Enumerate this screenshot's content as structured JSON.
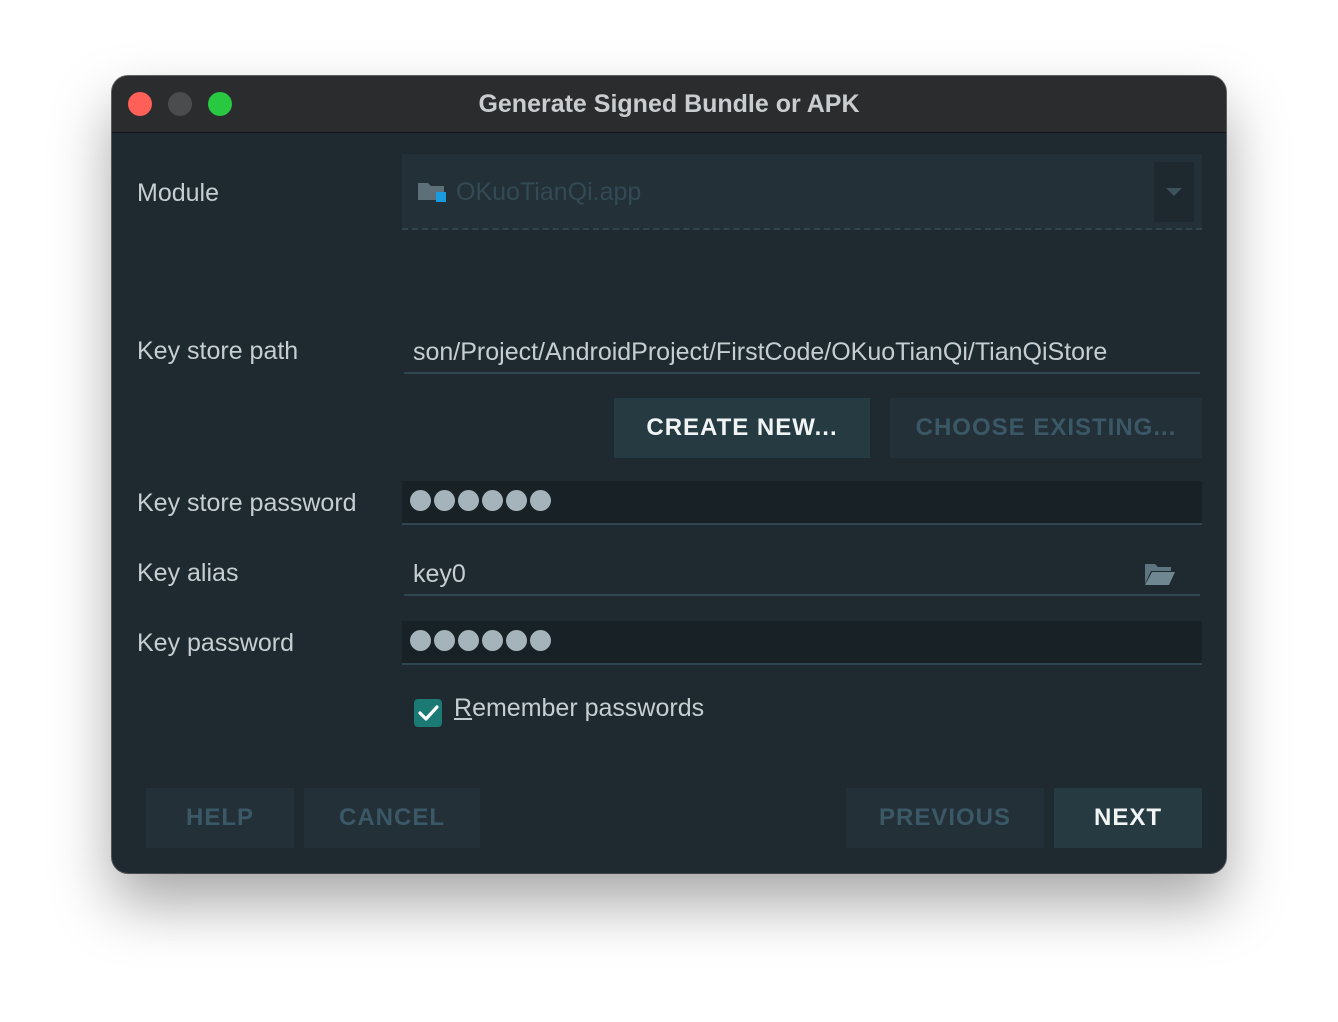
{
  "window": {
    "title": "Generate Signed Bundle or APK"
  },
  "module": {
    "label": "Module",
    "value": "OKuoTianQi.app",
    "icon": "module-folder-icon"
  },
  "keystore_path": {
    "label": "Key store path",
    "value": "son/Project/AndroidProject/FirstCode/OKuoTianQi/TianQiStore"
  },
  "keystore_buttons": {
    "create_new": "CREATE NEW...",
    "choose_existing": "CHOOSE EXISTING..."
  },
  "keystore_password": {
    "label": "Key store password",
    "masked_length": 6
  },
  "key_alias": {
    "label": "Key alias",
    "value": "key0",
    "icon": "open-folder-icon"
  },
  "key_password": {
    "label": "Key password",
    "masked_length": 6
  },
  "remember": {
    "mnemonic": "R",
    "rest": "emember passwords",
    "checked": true
  },
  "footer": {
    "help": "HELP",
    "cancel": "CANCEL",
    "previous": "PREVIOUS",
    "next": "NEXT"
  },
  "colors": {
    "accent": "#1b7a74",
    "background": "#1f2a30",
    "close": "#fe5f57",
    "maximize": "#28c840"
  }
}
